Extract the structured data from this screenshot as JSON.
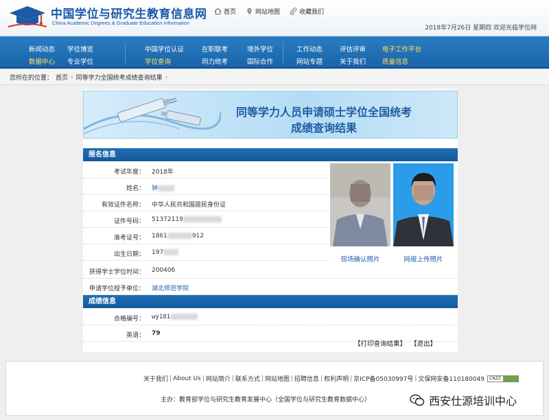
{
  "header": {
    "site_title": "中国学位与研究生教育信息网",
    "site_subtitle": "China Academic Degrees & Graduate Education Information",
    "links": [
      {
        "icon": "home-icon",
        "label": "首页"
      },
      {
        "icon": "location-pin-icon",
        "label": "网站地图"
      },
      {
        "icon": "paperclip-icon",
        "label": "收藏我们"
      }
    ],
    "date_line": "2018年7月26日  星期四  欢迎光临学位网"
  },
  "nav": {
    "col1": [
      "新闻动态",
      "数据中心"
    ],
    "col2": [
      "学位博览",
      "专业学位"
    ],
    "col3": [
      "中国学位认证",
      "学位查询"
    ],
    "col4": [
      "在职联考",
      "同力统考"
    ],
    "col5": [
      "境外学位",
      "国际合作"
    ],
    "col6": [
      "工作动态",
      "网站专题"
    ],
    "col7": [
      "评估评审",
      "关于我们"
    ],
    "col8": [
      "电子工作平台",
      "质量信息"
    ],
    "colors": {
      "active": "#ffe05a",
      "normal": "#ffffff",
      "bar": "#1a64a8"
    }
  },
  "breadcrumb": {
    "prefix": "您所在的位置：",
    "home": "首页",
    "sep1": "›",
    "current": "同等学力全国统考成绩查询结果",
    "sep2": "›"
  },
  "banner": {
    "line1": "同等学力人员申请硕士学位全国统考",
    "line2": "成绩查询结果"
  },
  "registration": {
    "heading": "报名信息",
    "fields": [
      {
        "label": "考试年度：",
        "value": "2018年"
      },
      {
        "label": "姓名：",
        "value": "钟"
      },
      {
        "label": "有效证件名称：",
        "value": "中华人民共和国居民身份证"
      },
      {
        "label": "证件号码：",
        "value": "51372119"
      },
      {
        "label": "准考证号：",
        "value": "1861",
        "value_tail": "912"
      },
      {
        "label": "出生日期：",
        "value": "197"
      },
      {
        "label": "获得学士学位时间：",
        "value": "200406"
      },
      {
        "label": "申请学位授予单位：",
        "value": "湖北师范学院"
      }
    ],
    "photo_captions": [
      "现场确认照片",
      "网报上传照片"
    ]
  },
  "scores": {
    "heading": "成绩信息",
    "fields": [
      {
        "label": "合格编号：",
        "value": "wy181"
      },
      {
        "label": "英语：",
        "value": "79"
      }
    ]
  },
  "actions": {
    "print": "【打印查询结果】",
    "exit": "【退出】"
  },
  "footer": {
    "links": [
      "关于我们",
      "About Us",
      "网站简介",
      "联系方式",
      "网站地图",
      "招聘信息",
      "权利声明",
      "京ICP备05030997号",
      "文保网安备110180049"
    ],
    "cnzz": "CNZZ",
    "sponsor": "主办：教育部学位与研究生教育发展中心（全国学位与研究生教育数据中心）",
    "watermark": "西安仕源培训中心"
  }
}
